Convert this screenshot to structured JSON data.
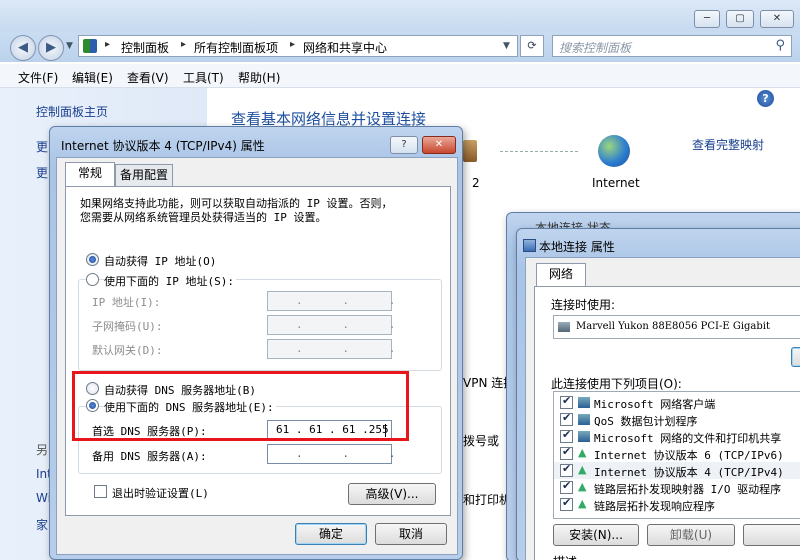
{
  "explorer": {
    "breadcrumbs": [
      "控制面板",
      "所有控制面板项",
      "网络和共享中心"
    ],
    "search_placeholder": "搜索控制面板",
    "menu": [
      "文件(F)",
      "编辑(E)",
      "查看(V)",
      "工具(T)",
      "帮助(H)"
    ],
    "left_home": "控制面板主页",
    "left_fragments": [
      "更",
      "更",
      "另",
      "Int",
      "Wi",
      "家"
    ],
    "main_title": "查看基本网络信息并设置连接",
    "full_map": "查看完整映射",
    "internet_label": "Internet",
    "network_fragment": "2",
    "mid_fragments": [
      "VPN 连接",
      "拨号或",
      "和打印机"
    ]
  },
  "ipv4_dialog": {
    "title": "Internet 协议版本 4 (TCP/IPv4) 属性",
    "tabs": [
      "常规",
      "备用配置"
    ],
    "description_line1": "如果网络支持此功能，则可以获取自动指派的 IP 设置。否则，",
    "description_line2": "您需要从网络系统管理员处获得适当的 IP 设置。",
    "auto_ip_label": "自动获得 IP 地址(O)",
    "manual_ip_label": "使用下面的 IP 地址(S):",
    "ip_address_label": "IP 地址(I):",
    "subnet_mask_label": "子网掩码(U):",
    "gateway_label": "默认网关(D):",
    "auto_dns_label": "自动获得 DNS 服务器地址(B)",
    "manual_dns_label": "使用下面的 DNS 服务器地址(E):",
    "preferred_dns_label": "首选 DNS 服务器(P):",
    "preferred_dns_value": "61 . 61 . 61 .255",
    "alternate_dns_label": "备用 DNS 服务器(A):",
    "validate_label": "退出时验证设置(L)",
    "advanced_button": "高级(V)...",
    "ok_button": "确定",
    "cancel_button": "取消",
    "selected": {
      "ip": "auto",
      "dns": "manual",
      "validate": false
    },
    "empty_ip": ".      .      ."
  },
  "local_dialog": {
    "behind_title": "本地连接 状态",
    "title": "本地连接 属性",
    "tab": "网络",
    "connect_using_label": "连接时使用:",
    "adapter": "Marvell Yukon 88E8056 PCI-E Gigabit",
    "configure_fragment": "配",
    "items_label": "此连接使用下列项目(O):",
    "items": [
      "Microsoft 网络客户端",
      "QoS 数据包计划程序",
      "Microsoft 网络的文件和打印机共享",
      "Internet 协议版本 6 (TCP/IPv6)",
      "Internet 协议版本 4 (TCP/IPv4)",
      "链路层拓扑发现映射器 I/O 驱动程序",
      "链路层拓扑发现响应程序"
    ],
    "install_button": "安装(N)...",
    "uninstall_button": "卸载(U)",
    "description_label": "描述"
  },
  "colors": {
    "highlight_box": "#e8151a",
    "link": "#1a3f8e",
    "title_blue": "#1e4fa0"
  }
}
